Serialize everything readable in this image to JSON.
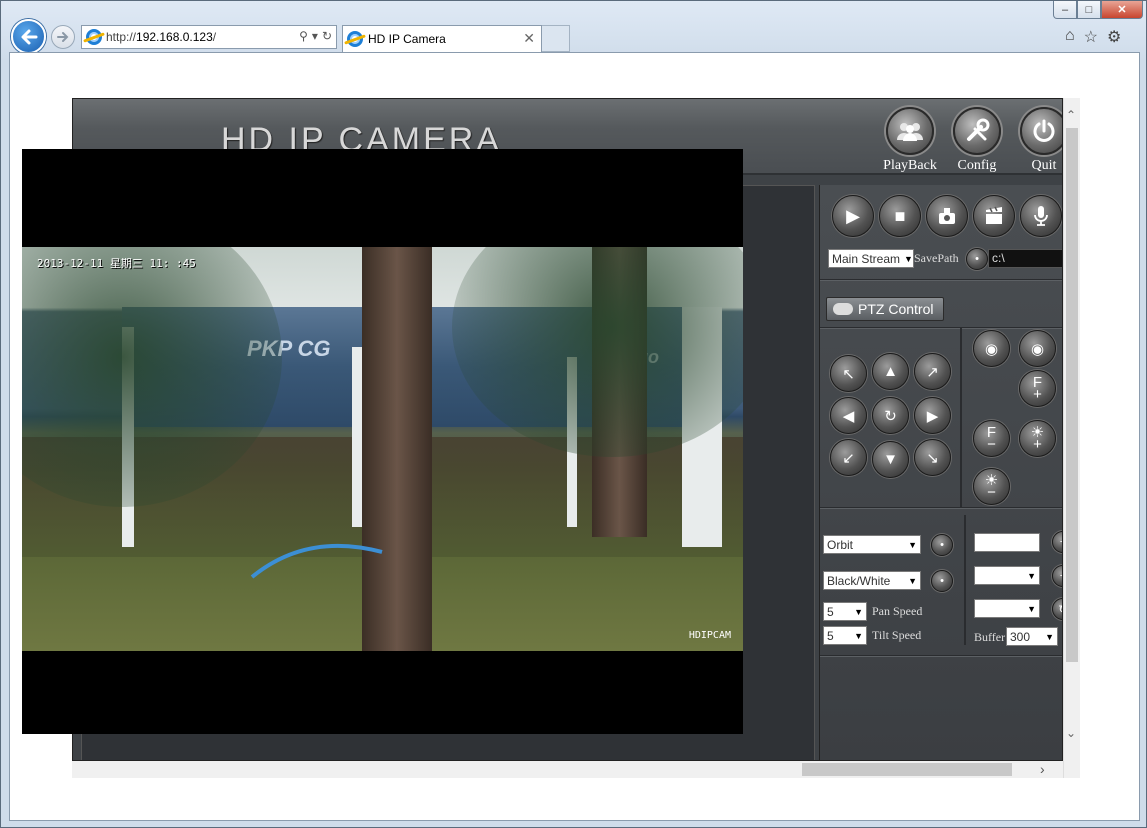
{
  "browser": {
    "address_prefix": "http://",
    "address_host": "192.168.0.123",
    "address_suffix": "/",
    "tab_title": "HD IP Camera",
    "window_controls": {
      "minimize": "–",
      "maximize": "□",
      "close": "✕"
    },
    "icons": [
      "back-arrow-icon",
      "forward-arrow-icon",
      "ie-icon",
      "search-icon",
      "refresh-icon",
      "home-icon",
      "star-icon",
      "gear-icon"
    ]
  },
  "app": {
    "title": "HD IP CAMERA",
    "header_buttons": [
      {
        "label": "PlayBack",
        "icon": "playback-icon"
      },
      {
        "label": "Config",
        "icon": "tools-icon"
      },
      {
        "label": "Quit",
        "icon": "power-icon"
      }
    ]
  },
  "video": {
    "timestamp": "2013-12-11 星期三 11:  :45",
    "watermark": "HDIPCAM",
    "train_text_left": "PKP CG",
    "train_text_right": "go"
  },
  "panel": {
    "stream_select": "Main Stream",
    "save_path_label": "SavePath",
    "save_path_value": "c:\\",
    "ptz_label": "PTZ Control",
    "cruise_select": "Orbit",
    "color_select": "Black/White",
    "pan_speed_value": "5",
    "pan_speed_label": "Pan Speed",
    "tilt_speed_value": "5",
    "tilt_speed_label": "Tilt Speed",
    "buffer_label": "Buffer",
    "buffer_value": "300",
    "zoom_focus_labels": {
      "focus_plus": "F",
      "focus_minus": "F"
    }
  }
}
